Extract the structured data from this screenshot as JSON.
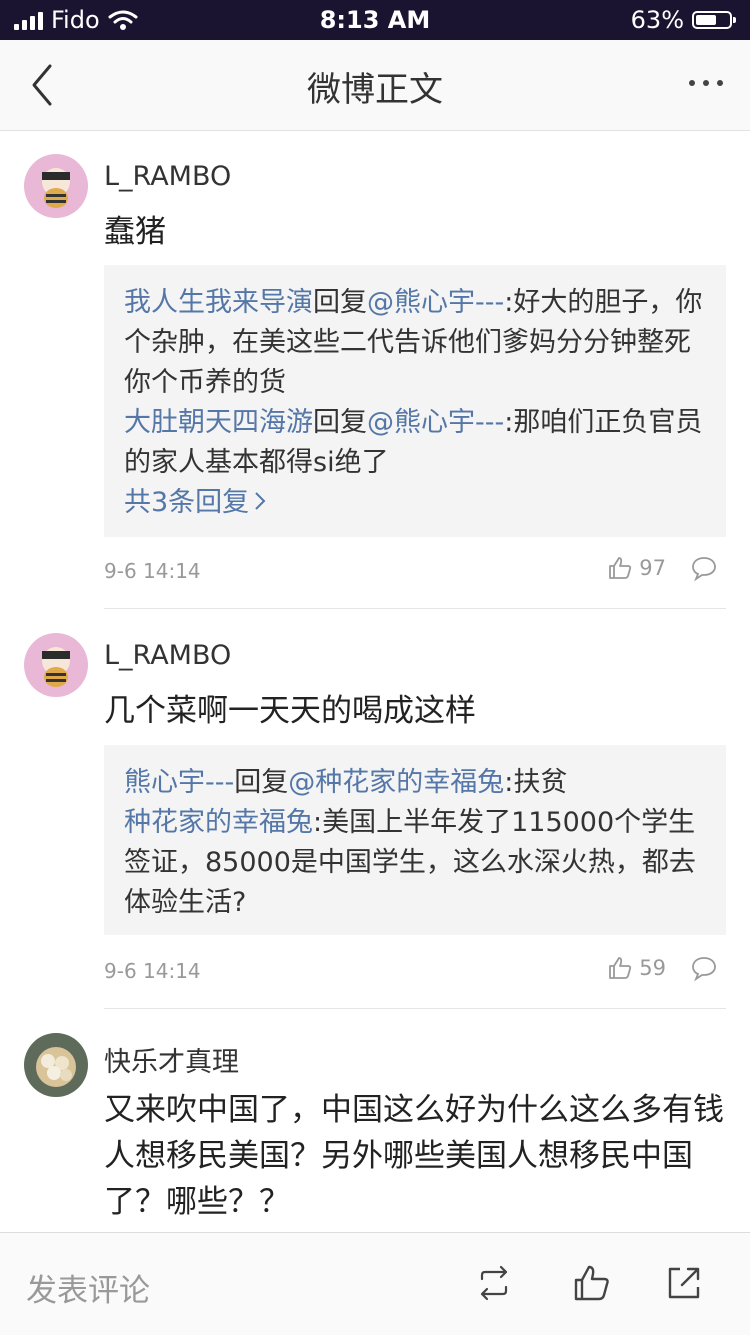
{
  "status_bar": {
    "carrier": "Fido",
    "time": "8:13 AM",
    "battery_percent": "63%",
    "battery_level": 0.63,
    "icons": [
      "signal-icon",
      "wifi-icon",
      "battery-icon"
    ]
  },
  "nav": {
    "title": "微博正文",
    "back_icon": "chevron-left-icon",
    "more_icon": "more-dots-icon"
  },
  "comments": [
    {
      "username": "L_RAMBO",
      "text": "蠢猪",
      "replies": [
        {
          "user": "我人生我来导演",
          "verb": "回复",
          "mention": "@熊心宇---",
          "text": ":好大的胆子，你个杂肿，在美这些二代告诉他们爹妈分分钟整死你个币养的货"
        },
        {
          "user": "大肚朝天四海游",
          "verb": "回复",
          "mention": "@熊心宇---",
          "text": ":那咱们正负官员的家人基本都得si绝了"
        }
      ],
      "more_replies": "共3条回复",
      "time": "9-6 14:14",
      "likes": "97"
    },
    {
      "username": "L_RAMBO",
      "text": "几个菜啊一天天的喝成这样",
      "replies": [
        {
          "user": "熊心宇---",
          "verb": "回复",
          "mention": "@种花家的幸福兔",
          "text": ":扶贫"
        },
        {
          "user": "种花家的幸福兔",
          "verb": "",
          "mention": "",
          "text": ":美国上半年发了115000个学生签证，85000是中国学生，这么水深火热，都去体验生活?"
        }
      ],
      "time": "9-6 14:14",
      "likes": "59"
    },
    {
      "username": "快乐才真理",
      "text": "又来吹中国了，中国这么好为什么这么多有钱人想移民美国？另外哪些美国人想移民中国了？哪些？？"
    }
  ],
  "toolbar": {
    "comment_placeholder": "发表评论",
    "icons": [
      "repost-icon",
      "like-icon",
      "share-icon"
    ]
  },
  "colors": {
    "status_bar_bg": "#1b1430",
    "link": "#5577a8",
    "reply_bg": "#f4f4f4"
  }
}
